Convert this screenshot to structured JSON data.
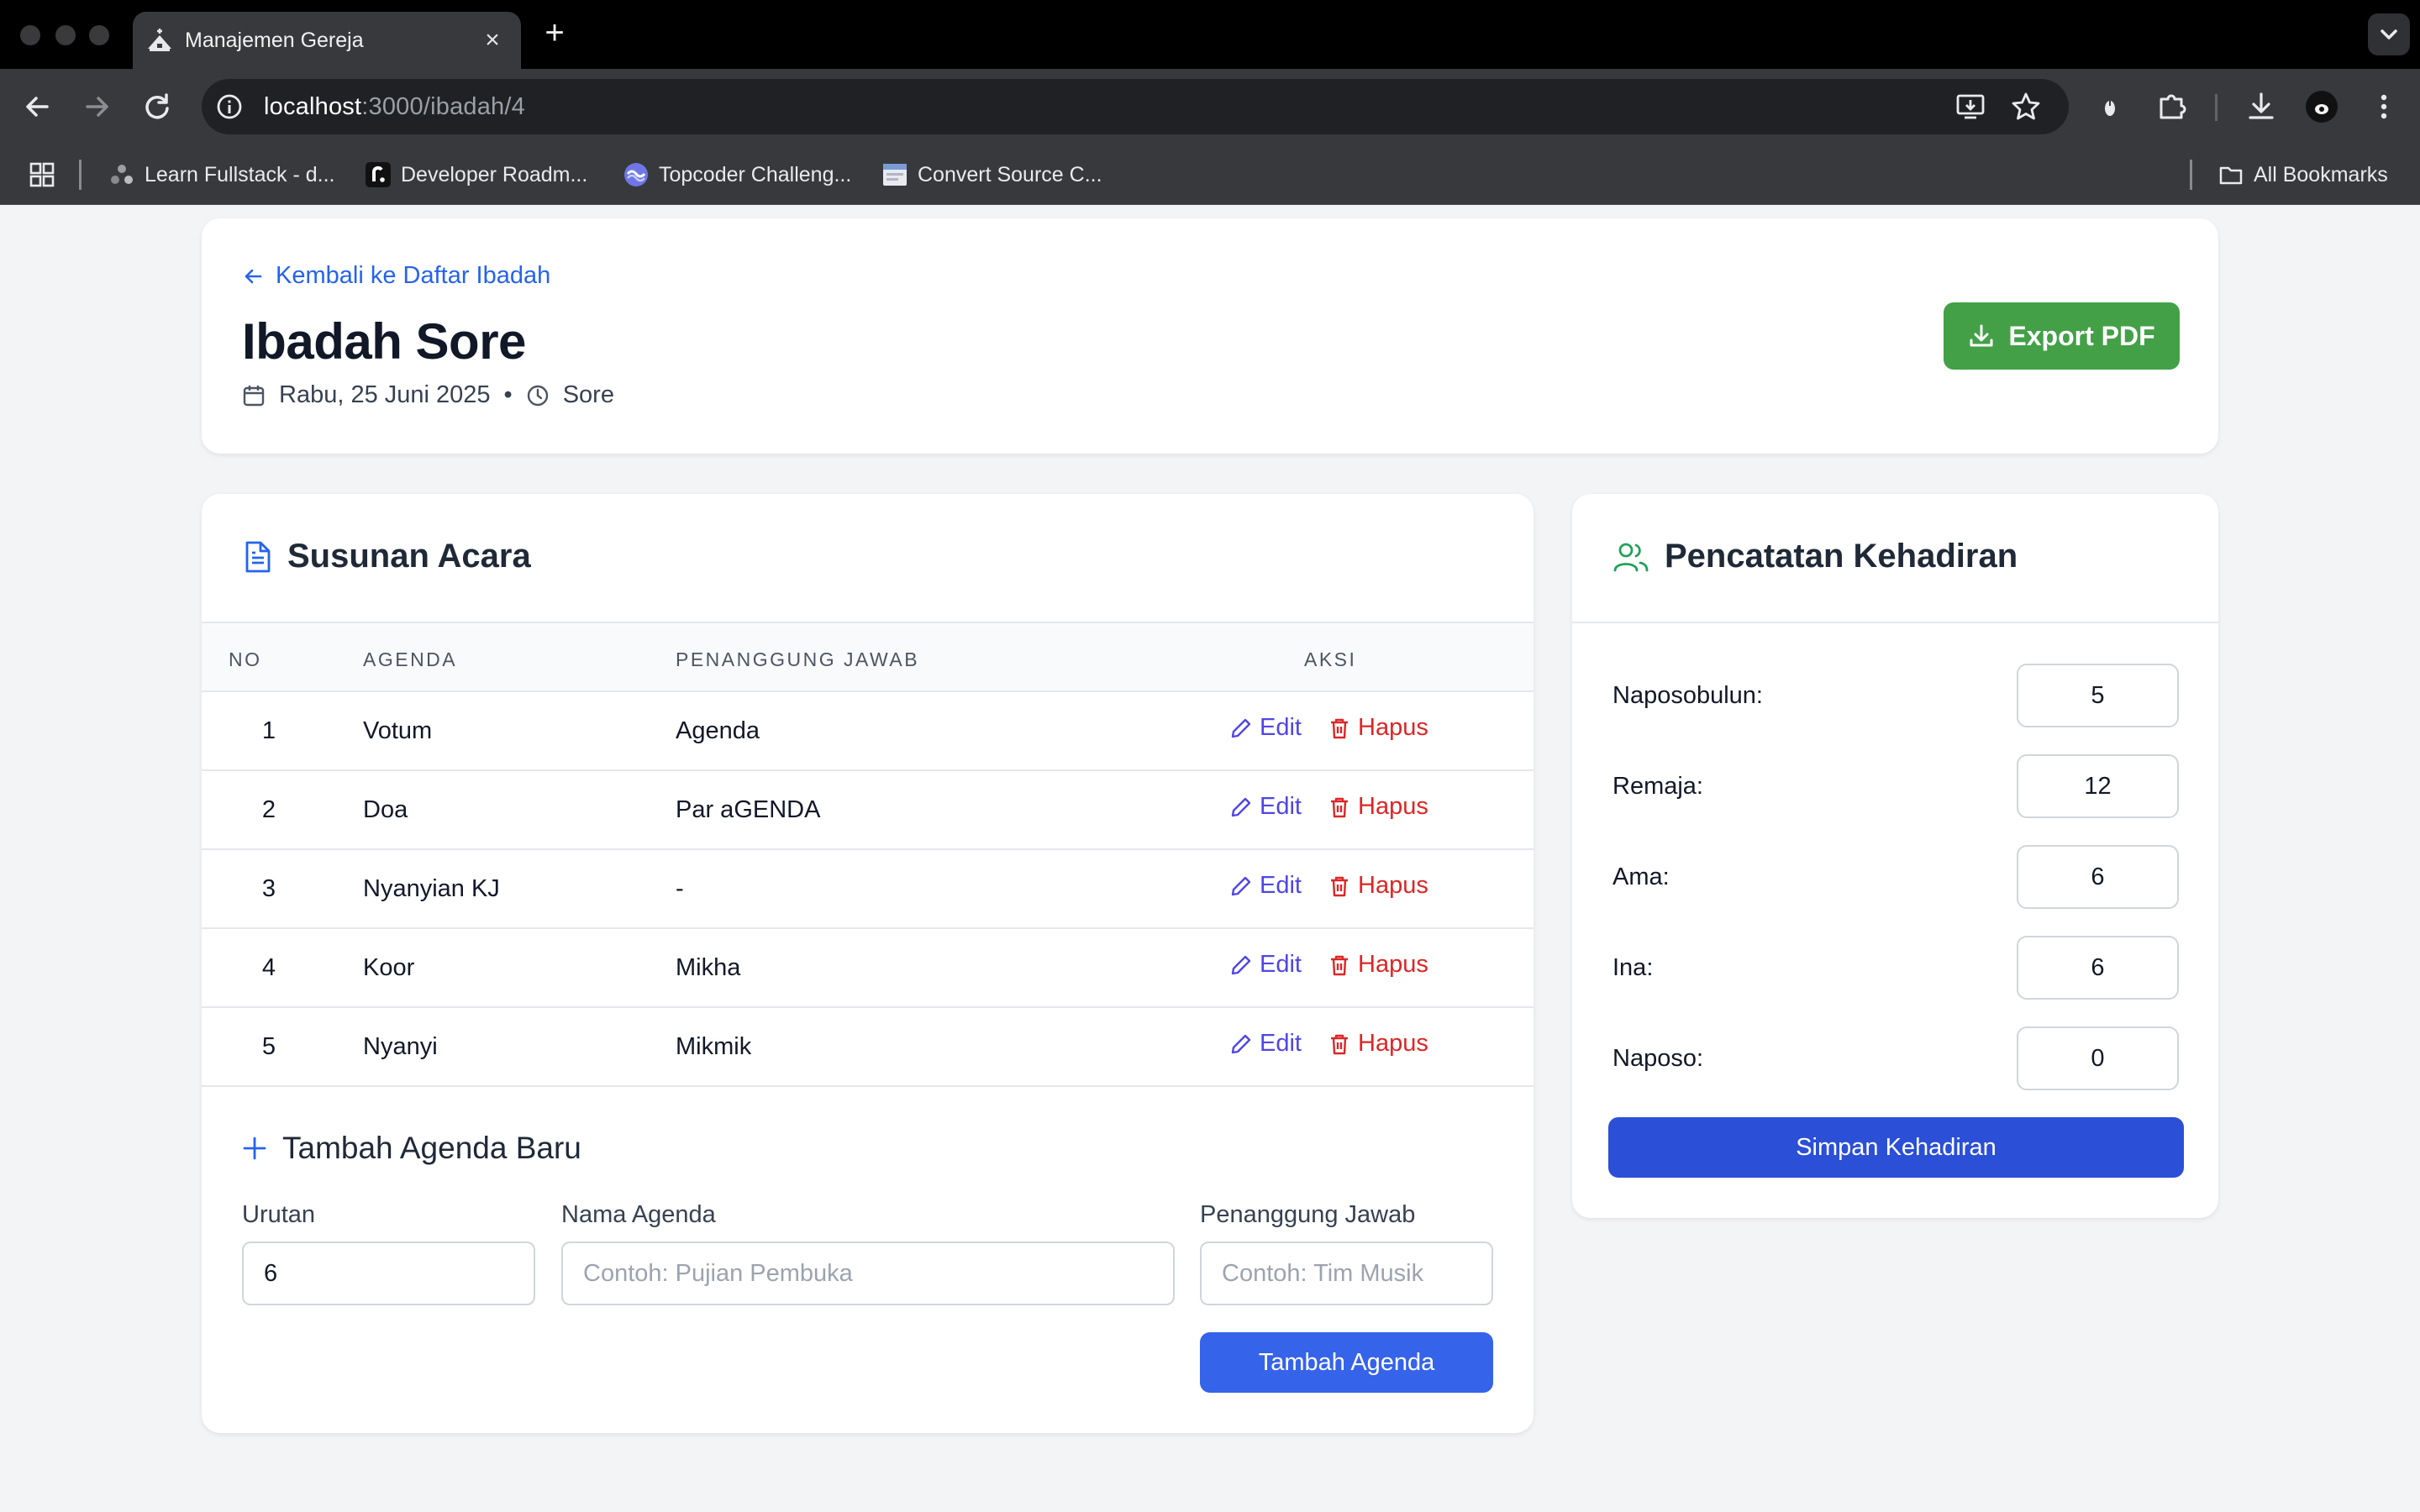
{
  "browser": {
    "tab_title": "Manajemen Gereja",
    "tab_close": "×",
    "new_tab": "+",
    "url_host": "localhost",
    "url_path": ":3000/ibadah/4",
    "bookmarks": [
      {
        "label": "Learn Fullstack - d...",
        "icon": "learn-fullstack-favicon"
      },
      {
        "label": "Developer Roadm...",
        "icon": "roadmap-favicon"
      },
      {
        "label": "Topcoder Challeng...",
        "icon": "topcoder-favicon"
      },
      {
        "label": "Convert Source C...",
        "icon": "convert-favicon"
      }
    ],
    "all_bookmarks": "All Bookmarks"
  },
  "header": {
    "back_link": "Kembali ke Daftar Ibadah",
    "title": "Ibadah Sore",
    "date": "Rabu, 25 Juni 2025",
    "separator": "•",
    "time": "Sore",
    "export_label": "Export PDF"
  },
  "agenda": {
    "title": "Susunan Acara",
    "columns": {
      "no": "NO",
      "agenda": "AGENDA",
      "pj": "PENANGGUNG JAWAB",
      "aksi": "AKSI"
    },
    "edit_label": "Edit",
    "delete_label": "Hapus",
    "rows": [
      {
        "no": "1",
        "agenda": "Votum",
        "pj": "Agenda"
      },
      {
        "no": "2",
        "agenda": "Doa",
        "pj": "Par aGENDA"
      },
      {
        "no": "3",
        "agenda": "Nyanyian KJ",
        "pj": "-"
      },
      {
        "no": "4",
        "agenda": "Koor",
        "pj": "Mikha"
      },
      {
        "no": "5",
        "agenda": "Nyanyi",
        "pj": "Mikmik"
      }
    ],
    "add": {
      "title": "Tambah Agenda Baru",
      "order_label": "Urutan",
      "order_value": "6",
      "name_label": "Nama Agenda",
      "name_placeholder": "Contoh: Pujian Pembuka",
      "pj_label": "Penanggung Jawab",
      "pj_placeholder": "Contoh: Tim Musik",
      "submit_label": "Tambah Agenda"
    }
  },
  "attendance": {
    "title": "Pencatatan Kehadiran",
    "items": [
      {
        "label": "Naposobulun:",
        "value": "5"
      },
      {
        "label": "Remaja:",
        "value": "12"
      },
      {
        "label": "Ama:",
        "value": "6"
      },
      {
        "label": "Ina:",
        "value": "6"
      },
      {
        "label": "Naposo:",
        "value": "0"
      }
    ],
    "save_label": "Simpan Kehadiran"
  },
  "colors": {
    "link_blue": "#2563eb",
    "export_green": "#43a047",
    "primary_blue": "#3563e9",
    "save_blue": "#2b4fd6",
    "edit_indigo": "#4f46e5",
    "delete_red": "#dc2626",
    "attendance_icon_green": "#22a05a"
  }
}
